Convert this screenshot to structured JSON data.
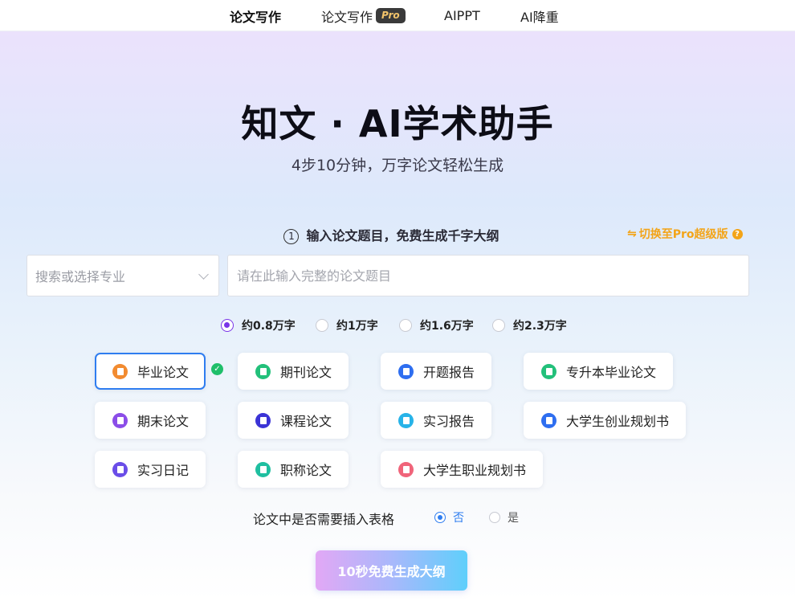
{
  "nav": {
    "items": [
      {
        "label": "论文写作",
        "active": true
      },
      {
        "label": "论文写作",
        "badge": "Pro"
      },
      {
        "label": "AIPPT"
      },
      {
        "label": "AI降重"
      }
    ]
  },
  "hero": {
    "title": "知文 · AI学术助手",
    "subtitle": "4步10分钟，万字论文轻松生成"
  },
  "step": {
    "number": "1",
    "title": "输入论文题目，免费生成千字大纲",
    "pro_switch": "切换至Pro超级版",
    "pro_switch_color": "#f3a418"
  },
  "form": {
    "major_placeholder": "搜索或选择专业",
    "topic_placeholder": "请在此输入完整的论文题目"
  },
  "word_counts": {
    "options": [
      "约0.8万字",
      "约1万字",
      "约1.6万字",
      "约2.3万字"
    ],
    "selected": "约0.8万字",
    "accent": "#7a35e8"
  },
  "paper_types": {
    "selected": "毕业论文",
    "items": [
      {
        "label": "毕业论文",
        "icon": "document-icon",
        "color": "#f28b30"
      },
      {
        "label": "期刊论文",
        "icon": "document-icon",
        "color": "#22c07a"
      },
      {
        "label": "开题报告",
        "icon": "report-icon",
        "color": "#2e6ef0"
      },
      {
        "label": "专升本毕业论文",
        "icon": "book-icon",
        "color": "#22c07a"
      },
      {
        "label": "期末论文",
        "icon": "document-icon",
        "color": "#8b4de8"
      },
      {
        "label": "课程论文",
        "icon": "course-icon",
        "color": "#3b33d6"
      },
      {
        "label": "实习报告",
        "icon": "report-icon",
        "color": "#27b3e8"
      },
      {
        "label": "大学生创业规划书",
        "icon": "plan-icon",
        "color": "#2e6ef0"
      },
      {
        "label": "实习日记",
        "icon": "diary-icon",
        "color": "#6a4de8"
      },
      {
        "label": "职称论文",
        "icon": "document-icon",
        "color": "#1fbfa0"
      },
      {
        "label": "大学生职业规划书",
        "icon": "career-icon",
        "color": "#f0647a"
      }
    ]
  },
  "table_option": {
    "question": "论文中是否需要插入表格",
    "no_label": "否",
    "yes_label": "是",
    "selected": "否"
  },
  "generate_button": "10秒免费生成大纲"
}
